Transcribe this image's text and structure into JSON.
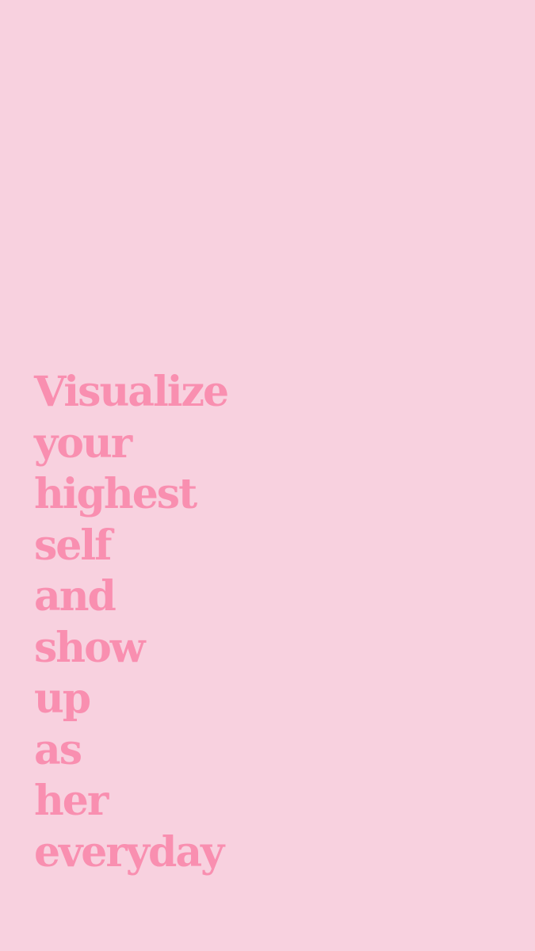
{
  "colors": {
    "background": "#f8d1df",
    "text": "#f98fb0"
  },
  "quote": {
    "lines": [
      "Visualize",
      "your",
      "highest",
      "self",
      "and",
      "show",
      "up",
      "as",
      "her",
      "everyday"
    ]
  }
}
